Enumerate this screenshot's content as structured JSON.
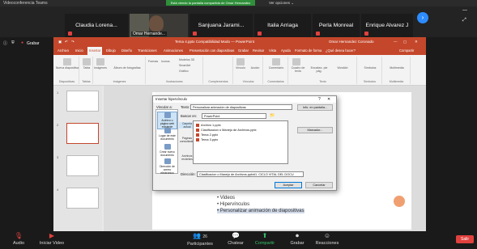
{
  "zoom_top": {
    "title": "Videoconferencia Teams",
    "share_banner": "Está viendo la pantalla compartida de Omar Hernandez",
    "view_options": "Ver opciones ⌄"
  },
  "participants": [
    {
      "name": "Claudia Lorena..."
    },
    {
      "name": "Sanjuana Jarami..."
    },
    {
      "name": "Italia Arriaga"
    },
    {
      "name": "Perla Monreal"
    },
    {
      "name": "Enrique Alvarez J"
    }
  ],
  "camera_tile": {
    "name": "Omar Hernande..."
  },
  "left_toolbar": {
    "record_label": "Grabar"
  },
  "ppt": {
    "title_bar": "Tema 4.pptx  Compatibilidad  Modo  —  PowerPoint",
    "user": "Omar Hernandez Coronado",
    "tabs": [
      "Archivo",
      "Inicio",
      "Insertar",
      "Dibujo",
      "Diseño",
      "Transiciones",
      "Animaciones",
      "Presentación con diapositivas",
      "Grabar",
      "Revisar",
      "Vista",
      "Ayuda",
      "Formato de forma",
      "¿Qué desea hacer?"
    ],
    "active_tab_index": 2,
    "share_label": "Compartir",
    "ribbon_groups": [
      "Diapositivas",
      "Tablas",
      "Imágenes",
      "Ilustraciones",
      "Complementos",
      "Vínculos",
      "Comentarios",
      "Texto",
      "Símbolos",
      "Multimedia"
    ],
    "ribbon_items": [
      "Nueva diapositiva",
      "Tabla",
      "Imágenes",
      "Álbum de fotografías",
      "Formas",
      "Iconos",
      "Modelos 3D",
      "SmartArt",
      "Gráfico",
      "Vínculo",
      "Acción",
      "Comentario",
      "Cuadro de texto",
      "Encabez. pie pág.",
      "WordArt",
      "Símbolos",
      "Multimedia"
    ],
    "slide_numbers": [
      "1",
      "2",
      "3",
      "4"
    ],
    "slide_bullets": [
      "Videos",
      "Hipervínculos",
      "Personalizar animación de diapositivas"
    ]
  },
  "dialog": {
    "title": "Insertar hipervínculo",
    "close": "✕",
    "help": "?",
    "link_to_label": "Vincular a:",
    "text_label": "Texto:",
    "text_value": "Personalizar animación de diapositivas",
    "screentip_button": "Info. en pantalla...",
    "link_options": [
      "Archivo o página web existente",
      "Lugar de este documento",
      "Crear nuevo documento",
      "Dirección de correo electrónico"
    ],
    "search_in_label": "Buscar en:",
    "search_in_value": "PowerPoint",
    "sub_options": [
      "Carpeta actual",
      "Páginas consultadas",
      "Archivos recientes"
    ],
    "files": [
      "Archivo 1.pptx",
      "Clasificacion o Manejo de Archivos.pptx",
      "Tema 2.pptx",
      "Tema 3.pptx"
    ],
    "browse_button": "Marcador...",
    "address_label": "Dirección:",
    "address_value": "Clasificacion o Manejo de Archivos.pptx#1. CICLO VITAL DEL DOCU",
    "ok_button": "Aceptar",
    "cancel_button": "Cancelar"
  },
  "bottom_bar": {
    "audio": "Audio",
    "video": "Iniciar Video",
    "participants": "Participantes",
    "participants_count": "26",
    "chat": "Chatear",
    "share": "Compartir",
    "record": "Grabar",
    "reactions": "Reacciones",
    "leave": "Salir"
  },
  "colors": {
    "ppt_accent": "#c4472b",
    "zoom_blue": "#2d8cff",
    "leave_red": "#e0413e",
    "share_green": "#2f8f3a"
  }
}
